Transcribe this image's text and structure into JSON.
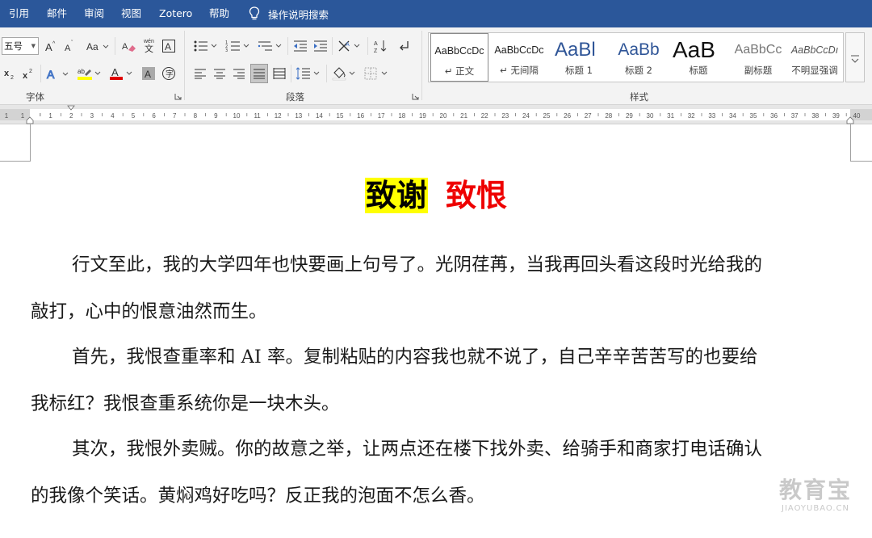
{
  "menu": {
    "tabs": [
      "引用",
      "邮件",
      "审阅",
      "视图",
      "Zotero",
      "帮助"
    ],
    "tell_me": "操作说明搜索"
  },
  "ribbon": {
    "font_size": "五号",
    "groups": {
      "font": "字体",
      "paragraph": "段落",
      "styles": "样式"
    },
    "styles_gallery": [
      {
        "sample": "AaBbCcDc",
        "name": "↵ 正文",
        "selected": true
      },
      {
        "sample": "AaBbCcDc",
        "name": "↵ 无间隔",
        "selected": false
      },
      {
        "sample": "AaBl",
        "name": "标题 1",
        "selected": false
      },
      {
        "sample": "AaBb",
        "name": "标题 2",
        "selected": false
      },
      {
        "sample": "AaB",
        "name": "标题",
        "selected": false
      },
      {
        "sample": "AaBbCc",
        "name": "副标题",
        "selected": false
      },
      {
        "sample": "AaBbCcDı",
        "name": "不明显强调",
        "selected": false
      }
    ]
  },
  "ruler": {
    "left_numbers": [
      "1",
      "1"
    ],
    "numbers": [
      "1",
      "2",
      "3",
      "4",
      "5",
      "6",
      "7",
      "8",
      "9",
      "10",
      "11",
      "12",
      "13",
      "14",
      "15",
      "16",
      "17",
      "18",
      "19",
      "20",
      "21",
      "22",
      "23",
      "24",
      "25",
      "26",
      "27",
      "28",
      "29",
      "30",
      "31",
      "32",
      "33",
      "34",
      "35",
      "36",
      "37",
      "38",
      "39",
      "40"
    ]
  },
  "document": {
    "title_part1": "致谢",
    "title_part2": "致恨",
    "paragraphs": [
      [
        "行文至此，我的大学四年也快要画上句号了。光阴荏苒，当我再回头看这段时光给我的",
        "敲打，心中的恨意油然而生。"
      ],
      [
        "首先，我恨查重率和 AI 率。复制粘贴的内容我也就不说了，自己辛辛苦苦写的也要给",
        "我标红？我恨查重系统你是一块木头。"
      ],
      [
        "其次，我恨外卖贼。你的故意之举，让两点还在楼下找外卖、给骑手和商家打电话确认",
        "的我像个笑话。黄焖鸡好吃吗？反正我的泡面不怎么香。"
      ]
    ]
  },
  "watermark": {
    "text": "教育宝",
    "url": "JIAOYUBAO.CN"
  },
  "colors": {
    "menubar": "#2b579a",
    "highlight": "#ffff00",
    "title_red": "#ee0000"
  }
}
